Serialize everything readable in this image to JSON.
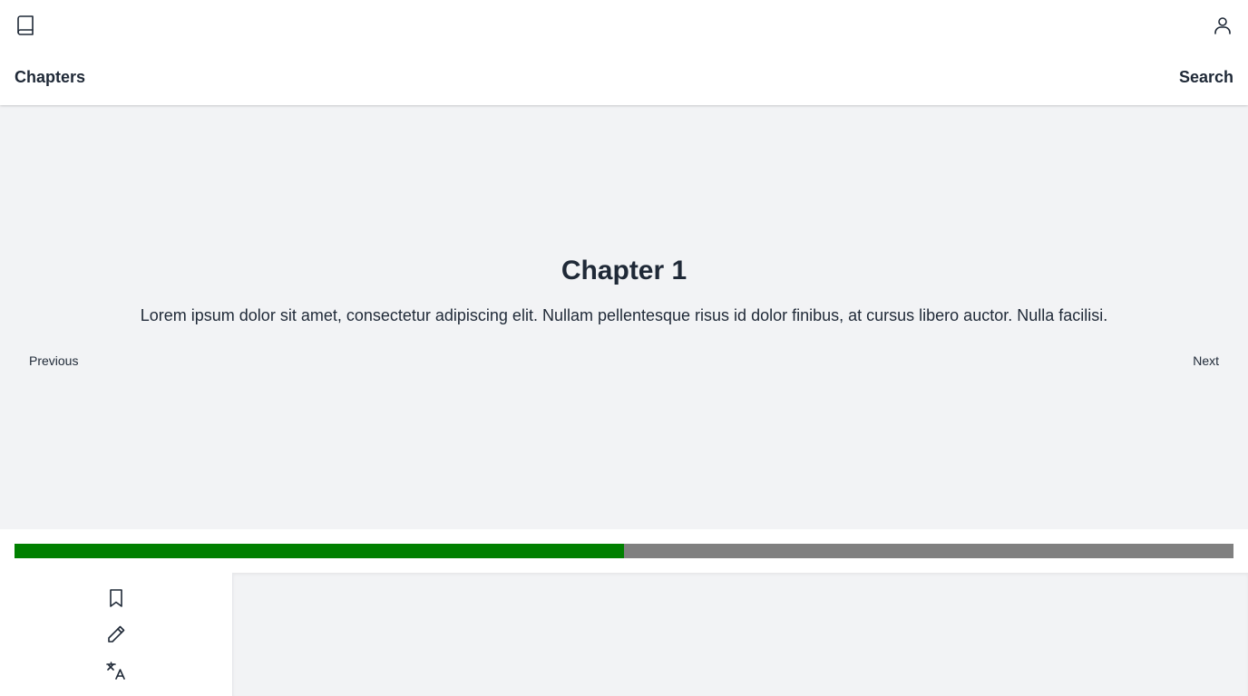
{
  "header": {
    "book_icon": "book-icon",
    "user_icon": "user-icon",
    "chapters_label": "Chapters",
    "search_label": "Search"
  },
  "reader": {
    "chapter_title": "Chapter 1",
    "chapter_text": "Lorem ipsum dolor sit amet, consectetur adipiscing elit. Nullam pellentesque risus id dolor finibus, at cursus libero auctor. Nulla facilisi.",
    "previous_label": "Previous",
    "next_label": "Next"
  },
  "progress": {
    "fraction": 0.5,
    "fill_color": "#008000",
    "track_color": "#808080"
  },
  "toolbar": {
    "icons": [
      "bookmark-icon",
      "pencil-icon",
      "translate-icon"
    ]
  },
  "colors": {
    "background": "#f2f3f5",
    "surface": "#ffffff",
    "text": "#1f2937"
  }
}
